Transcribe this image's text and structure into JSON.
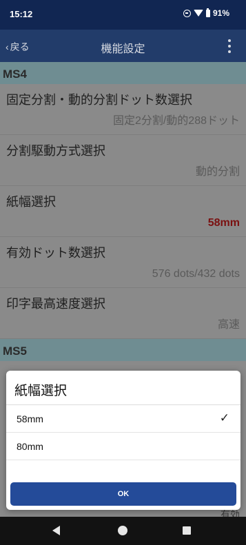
{
  "status_bar": {
    "time": "15:12",
    "battery": "91%"
  },
  "app_bar": {
    "back_label": "戻る",
    "title": "機能設定"
  },
  "sections": [
    {
      "header": "MS4",
      "items": [
        {
          "label": "固定分割・動的分割ドット数選択",
          "value": "固定2分割/動的288ドット"
        },
        {
          "label": "分割駆動方式選択",
          "value": "動的分割"
        },
        {
          "label": "紙幅選択",
          "value": "58mm"
        },
        {
          "label": "有効ドット数選択",
          "value": "576 dots/432 dots"
        },
        {
          "label": "印字最高速度選択",
          "value": "高速"
        }
      ]
    },
    {
      "header": "MS5",
      "peek_value": "有効"
    }
  ],
  "dialog": {
    "title": "紙幅選択",
    "options": [
      {
        "label": "58mm",
        "selected": true
      },
      {
        "label": "80mm",
        "selected": false
      }
    ],
    "check_glyph": "✓",
    "ok_label": "OK"
  },
  "colors": {
    "status_bar": "#112652",
    "app_bar": "#223c6a",
    "accent_value": "#7a1010",
    "ok_button": "#244b99"
  }
}
